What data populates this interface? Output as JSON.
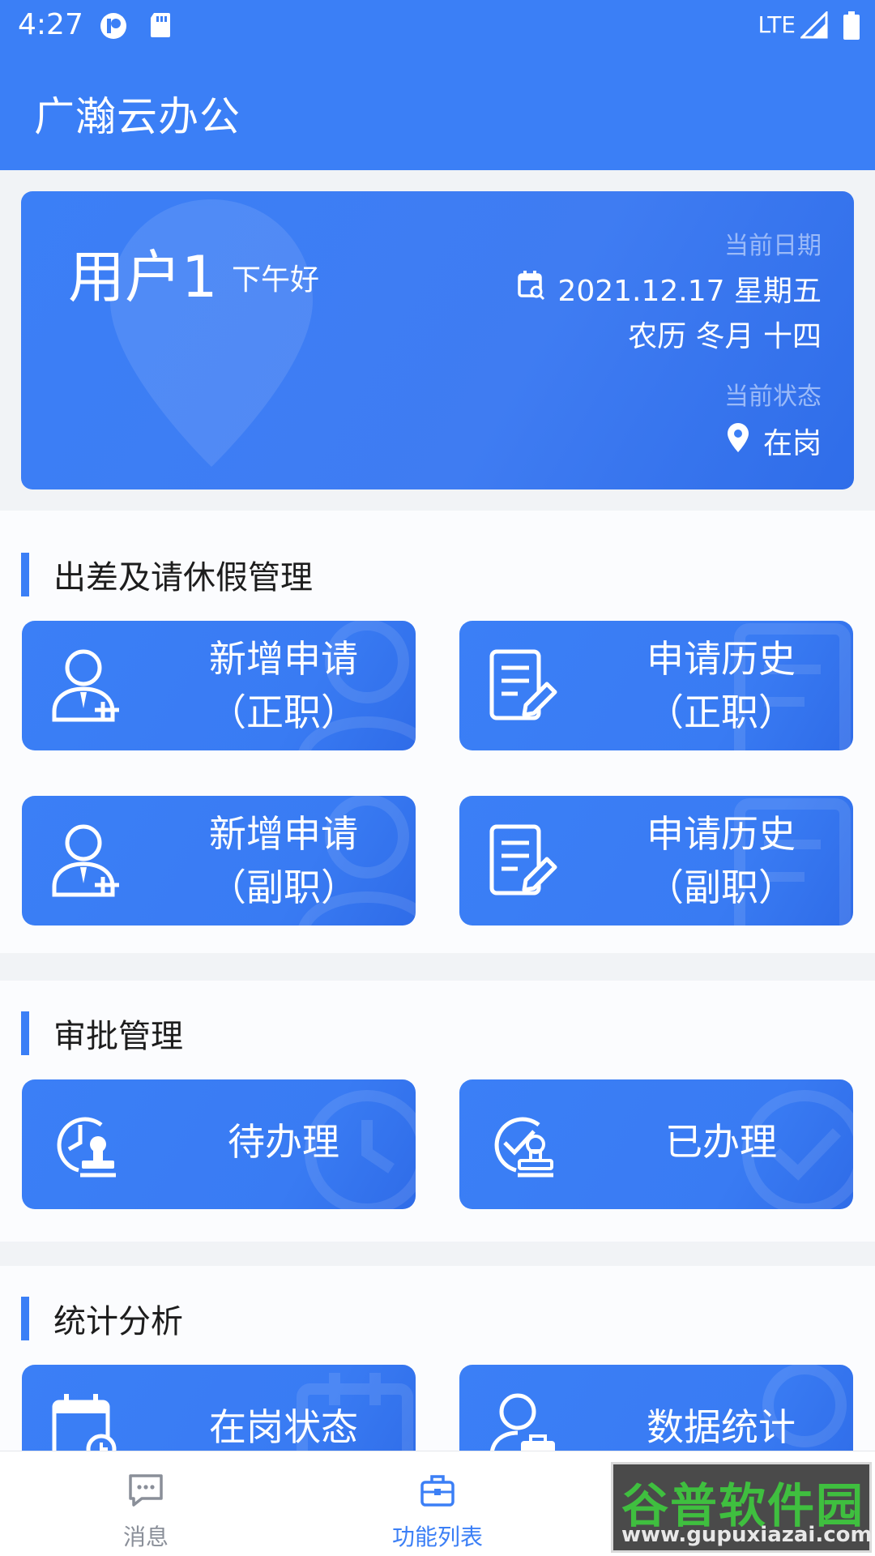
{
  "status_bar": {
    "time": "4:27",
    "network": "LTE"
  },
  "app": {
    "title": "广瀚云办公"
  },
  "user_card": {
    "user_name": "用户1",
    "greeting": "下午好",
    "date_label": "当前日期",
    "date": "2021.12.17 星期五",
    "lunar": "农历 冬月 十四",
    "state_label": "当前状态",
    "state": "在岗"
  },
  "sections": [
    {
      "title": "出差及请休假管理",
      "tiles": [
        {
          "line1": "新增申请",
          "line2": "（正职）",
          "icon": "add-user-icon"
        },
        {
          "line1": "申请历史",
          "line2": "（正职）",
          "icon": "document-edit-icon"
        },
        {
          "line1": "新增申请",
          "line2": "（副职）",
          "icon": "add-user-icon"
        },
        {
          "line1": "申请历史",
          "line2": "（副职）",
          "icon": "document-edit-icon"
        }
      ]
    },
    {
      "title": "审批管理",
      "tiles": [
        {
          "label": "待办理",
          "icon": "clock-stamp-icon"
        },
        {
          "label": "已办理",
          "icon": "check-stamp-icon"
        }
      ]
    },
    {
      "title": "统计分析",
      "tiles": [
        {
          "label": "在岗状态",
          "icon": "calendar-clock-icon"
        },
        {
          "label": "数据统计",
          "icon": "user-briefcase-icon"
        }
      ]
    }
  ],
  "bottom_nav": {
    "items": [
      {
        "label": "消息",
        "icon": "chat-icon",
        "active": false
      },
      {
        "label": "功能列表",
        "icon": "briefcase-icon",
        "active": true
      }
    ]
  },
  "watermark": {
    "cn": "谷普软件园",
    "en": "www.gupuxiazai.com"
  },
  "colors": {
    "primary": "#3b7ff6",
    "background": "#f1f3f6",
    "inactive": "#8a8f99"
  }
}
